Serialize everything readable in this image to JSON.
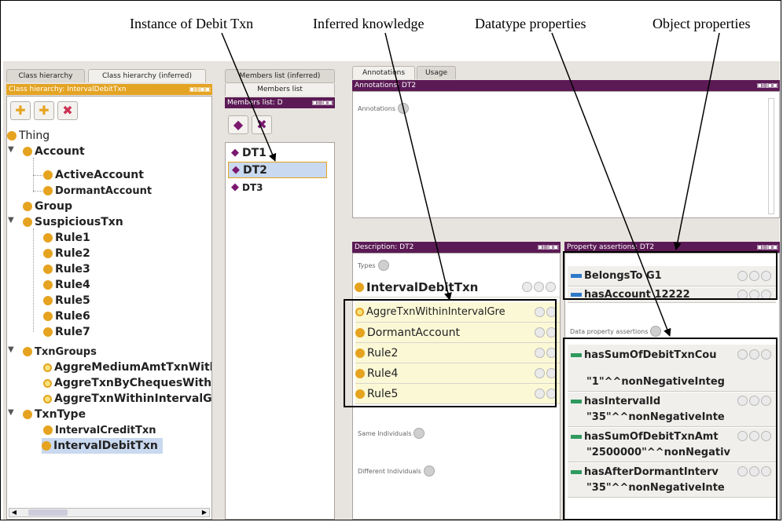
{
  "callouts": {
    "instance": "Instance of Debit Txn",
    "inferred": "Inferred knowledge",
    "datatype": "Datatype properties",
    "object": "Object properties"
  },
  "left_tabs": [
    "Class hierarchy",
    "Class hierarchy (inferred)"
  ],
  "class_panel_title": "Class hierarchy: IntervalDebitTxn",
  "class_tree": [
    {
      "label": "Thing"
    },
    {
      "label": "Account"
    },
    {
      "label": "ActiveAccount"
    },
    {
      "label": "DormantAccount"
    },
    {
      "label": "Group"
    },
    {
      "label": "SuspiciousTxn"
    },
    {
      "label": "Rule1"
    },
    {
      "label": "Rule2"
    },
    {
      "label": "Rule3"
    },
    {
      "label": "Rule4"
    },
    {
      "label": "Rule5"
    },
    {
      "label": "Rule6"
    },
    {
      "label": "Rule7"
    },
    {
      "label": "TxnGroups"
    },
    {
      "label": "AggreMediumAmtTxnWith"
    },
    {
      "label": "AggreTxnByChequesWith"
    },
    {
      "label": "AggreTxnWithinIntervalG"
    },
    {
      "label": "TxnType"
    },
    {
      "label": "IntervalCreditTxn"
    },
    {
      "label": "IntervalDebitTxn"
    }
  ],
  "members_tabs": [
    "Members list (inferred)",
    "Members list"
  ],
  "members_title": "Members list: D",
  "members": [
    "DT1",
    "DT2",
    "DT3"
  ],
  "right_tabs": [
    "Annotations",
    "Usage"
  ],
  "annotations_title": "Annotations: DT2",
  "annotations_label": "Annotations",
  "description_title": "Description: DT2",
  "types_label": "Types",
  "types": [
    {
      "label": "IntervalDebitTxn",
      "inferred": false
    },
    {
      "label": "AggreTxnWithinIntervalGre",
      "inferred": true
    },
    {
      "label": "DormantAccount",
      "inferred": true
    },
    {
      "label": "Rule2",
      "inferred": true
    },
    {
      "label": "Rule4",
      "inferred": true
    },
    {
      "label": "Rule5",
      "inferred": true
    }
  ],
  "same_individuals_label": "Same Individuals",
  "different_individuals_label": "Different Individuals",
  "property_title": "Property assertions: DT2",
  "object_properties": [
    {
      "name": "BelongsTo",
      "value": "G1"
    },
    {
      "name": "hasAccount",
      "value": "12222"
    }
  ],
  "data_property_label": "Data property assertions",
  "data_properties": [
    {
      "name": "hasSumOfDebitTxnCou",
      "value": "\"1\"^^nonNegativeInteg"
    },
    {
      "name": "hasIntervalId",
      "value": "\"35\"^^nonNegativeInte"
    },
    {
      "name": "hasSumOfDebitTxnAmt",
      "value": "\"2500000\"^^nonNegativ"
    },
    {
      "name": "hasAfterDormantInterv",
      "value": "\"35\"^^nonNegativeInte"
    }
  ],
  "colors": {
    "accent": "#5b1a55",
    "class_dot": "#e6a31f",
    "individual": "#7a1870",
    "object_prop": "#2f79c8",
    "data_prop": "#2f9a5e"
  }
}
